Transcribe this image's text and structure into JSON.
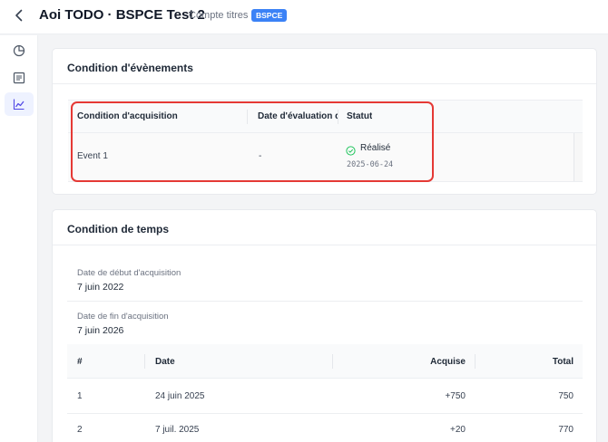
{
  "header": {
    "title": "Aoi TODO · BSPCE Test 2",
    "subtitle": "Compte titres",
    "badge": "BSPCE"
  },
  "sidebar": {
    "items": [
      {
        "icon": "pie-chart-icon",
        "active": false
      },
      {
        "icon": "document-list-icon",
        "active": false
      },
      {
        "icon": "line-chart-icon",
        "active": true
      }
    ]
  },
  "events_card": {
    "title": "Condition d'évènements",
    "columns": [
      "Condition d'acquisition",
      "Date d'évaluation d",
      "Statut"
    ],
    "rows": [
      {
        "condition": "Event 1",
        "date": "-",
        "status": "Réalisé",
        "status_date": "2025-06-24"
      }
    ]
  },
  "time_card": {
    "title": "Condition de temps",
    "start_label": "Date de début d'acquisition",
    "start_value": "7 juin 2022",
    "end_label": "Date de fin d'acquisition",
    "end_value": "7 juin 2026",
    "columns": [
      "#",
      "Date",
      "Acquise",
      "Total"
    ],
    "rows": [
      {
        "num": "1",
        "date": "24 juin 2025",
        "acquired": "+750",
        "total": "750"
      },
      {
        "num": "2",
        "date": "7 juil. 2025",
        "acquired": "+20",
        "total": "770"
      }
    ]
  },
  "colors": {
    "accent": "#3b82f6",
    "success": "#22c55e",
    "highlight": "#e53935"
  }
}
